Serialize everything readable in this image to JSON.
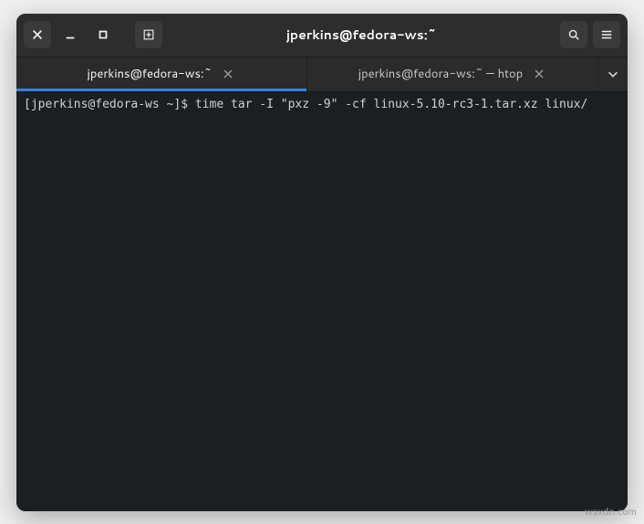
{
  "window": {
    "title": "jperkins@fedora-ws:~"
  },
  "tabs": [
    {
      "label": "jperkins@fedora-ws:~",
      "active": true
    },
    {
      "label": "jperkins@fedora-ws:~ — htop",
      "active": false
    }
  ],
  "terminal": {
    "prompt_open": "[",
    "prompt_user_host": "jperkins@fedora-ws",
    "prompt_sep": " ",
    "prompt_path": "~",
    "prompt_close": "]$ ",
    "command": "time tar -I \"pxz -9\" -cf linux-5.10-rc3-1.tar.xz linux/"
  },
  "watermark": "wsxdn.com"
}
